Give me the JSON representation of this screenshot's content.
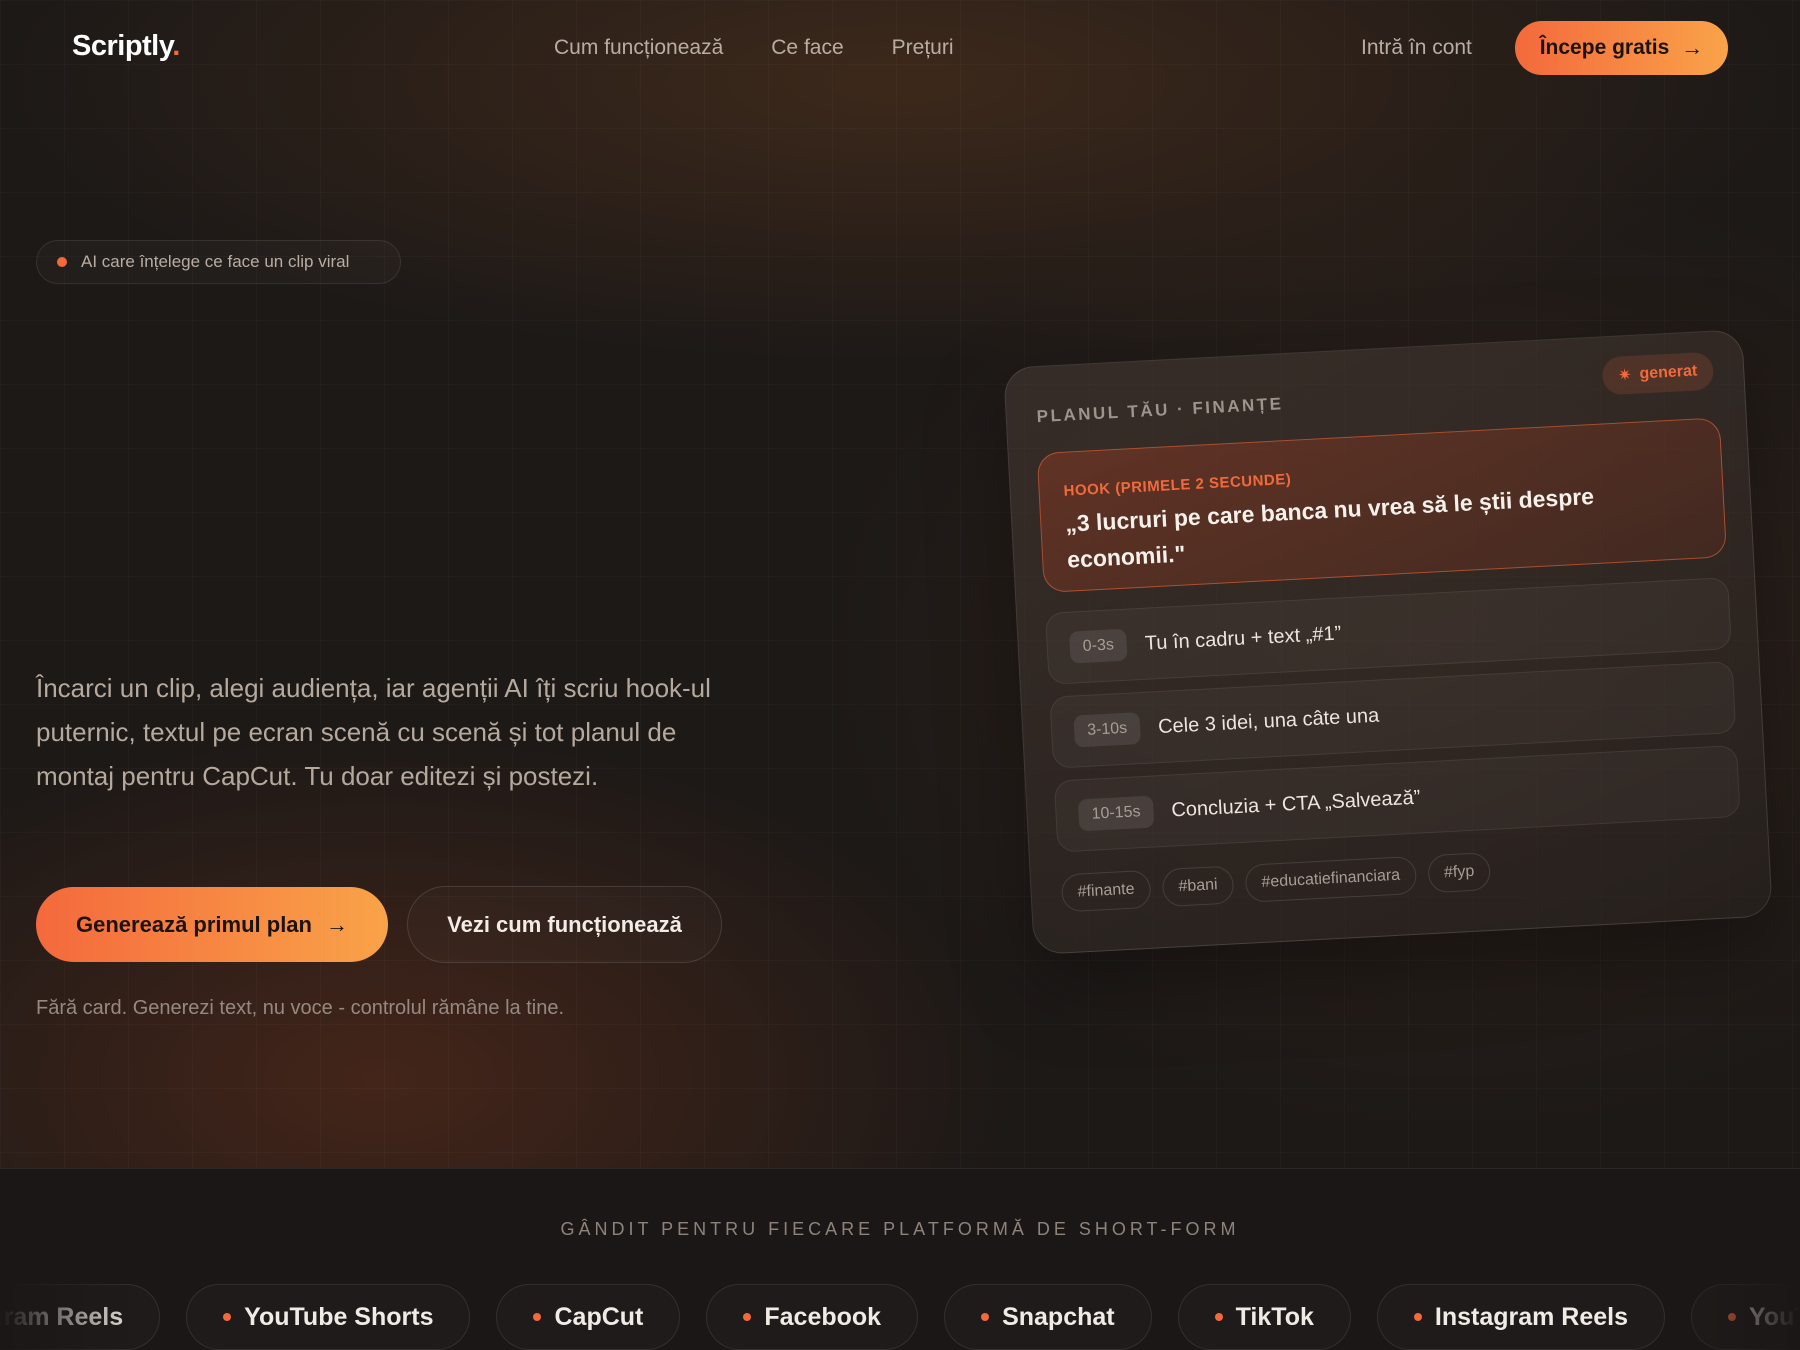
{
  "nav": {
    "logo_text": "Scriptly",
    "logo_dot": ".",
    "links": [
      "Cum funcționează",
      "Ce face",
      "Prețuri"
    ],
    "login": "Intră în cont",
    "cta": "Începe gratis",
    "cta_icon": "arrow-right-icon"
  },
  "hero": {
    "badge": "AI care înțelege ce face un clip viral",
    "description": "Încarci un clip, alegi audiența, iar agenții AI îți scriu hook-ul puternic, textul pe ecran scenă cu scenă și tot planul de montaj pentru CapCut. Tu doar editezi și postezi.",
    "primary_button": "Generează primul plan",
    "secondary_button": "Vezi cum funcționează",
    "note": "Fără card. Generezi text, nu voce - controlul rămâne la tine."
  },
  "plan_card": {
    "title": "PLANUL TĂU · FINANȚE",
    "badge": "generat",
    "badge_icon": "sparkle-icon",
    "hook_label": "HOOK (PRIMELE 2 SECUNDE)",
    "hook_text": "„3 lucruri pe care banca nu vrea să le știi despre economii.\"",
    "scenes": [
      {
        "time": "0-3s",
        "text": "Tu în cadru + text „#1”"
      },
      {
        "time": "3-10s",
        "text": "Cele 3 idei, una câte una"
      },
      {
        "time": "10-15s",
        "text": "Concluzia + CTA „Salvează”"
      }
    ],
    "tags": [
      "#finante",
      "#bani",
      "#educatiefinanciara",
      "#fyp"
    ]
  },
  "platforms": {
    "title": "GÂNDIT PENTRU FIECARE PLATFORMĂ DE SHORT-FORM",
    "items": [
      "Instagram Reels",
      "YouTube Shorts",
      "CapCut",
      "Facebook",
      "Snapchat",
      "TikTok",
      "Instagram Reels",
      "YouTube Shorts"
    ]
  },
  "colors": {
    "accent": "#f26a3c",
    "accent_end": "#f9a349",
    "background": "#1d1917"
  }
}
